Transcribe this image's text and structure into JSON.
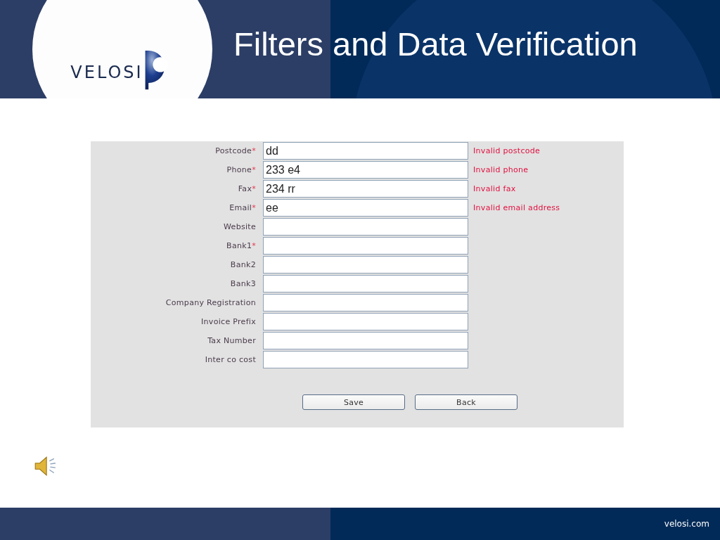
{
  "header": {
    "logo_text": "VELOSI",
    "title": "Filters and Data Verification"
  },
  "form": {
    "fields": [
      {
        "label": "Postcode",
        "required_mark": "*",
        "value": "dd",
        "error": "Invalid postcode"
      },
      {
        "label": "Phone",
        "required_mark": "*",
        "value": "233 e4",
        "error": "Invalid phone"
      },
      {
        "label": "Fax",
        "required_mark": "*",
        "value": "234 rr",
        "error": "Invalid fax"
      },
      {
        "label": "Email",
        "required_mark": "*",
        "value": "ee",
        "error": "Invalid email address"
      },
      {
        "label": "Website"
      },
      {
        "label": "Bank1",
        "required_mark": "*"
      },
      {
        "label": "Bank2"
      },
      {
        "label": "Bank3"
      },
      {
        "label": "Company Registration"
      },
      {
        "label": "Invoice Prefix"
      },
      {
        "label": "Tax Number"
      },
      {
        "label": "Inter co cost"
      }
    ],
    "buttons": [
      "Save",
      "Back"
    ]
  },
  "footer": {
    "text": "velosi.com"
  }
}
